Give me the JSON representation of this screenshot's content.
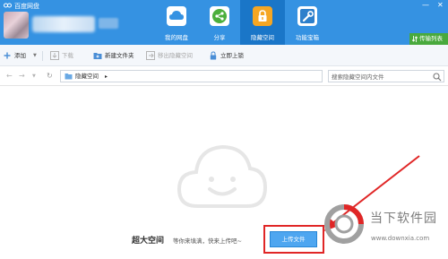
{
  "app": {
    "title": "百度网盘"
  },
  "nav": {
    "tabs": [
      {
        "label": "我的网盘",
        "active": false
      },
      {
        "label": "分享",
        "active": false
      },
      {
        "label": "隐藏空间",
        "active": true
      },
      {
        "label": "功能宝箱",
        "active": false
      }
    ]
  },
  "window_controls": {
    "minimize": "—",
    "close": "✕"
  },
  "transfer": {
    "label": "传输列表"
  },
  "toolbar": {
    "add": "添加",
    "download": "下载",
    "new_folder": "新建文件夹",
    "move_out": "移出隐藏空间",
    "lock": "立即上锁"
  },
  "address": {
    "path": "隐藏空间",
    "search_placeholder": "搜索隐藏空间内文件"
  },
  "empty_state": {
    "title": "超大空间",
    "subtitle": "等你来填满，快来上传吧~",
    "upload_button": "上传文件"
  },
  "watermark": {
    "title": "当下软件园",
    "url": "www.downxia.com"
  },
  "colors": {
    "header": "#3592e2",
    "active_tab": "#1a76c8",
    "transfer": "#49a93d",
    "highlight": "#e02626",
    "upload_button": "#4ea6f0"
  }
}
